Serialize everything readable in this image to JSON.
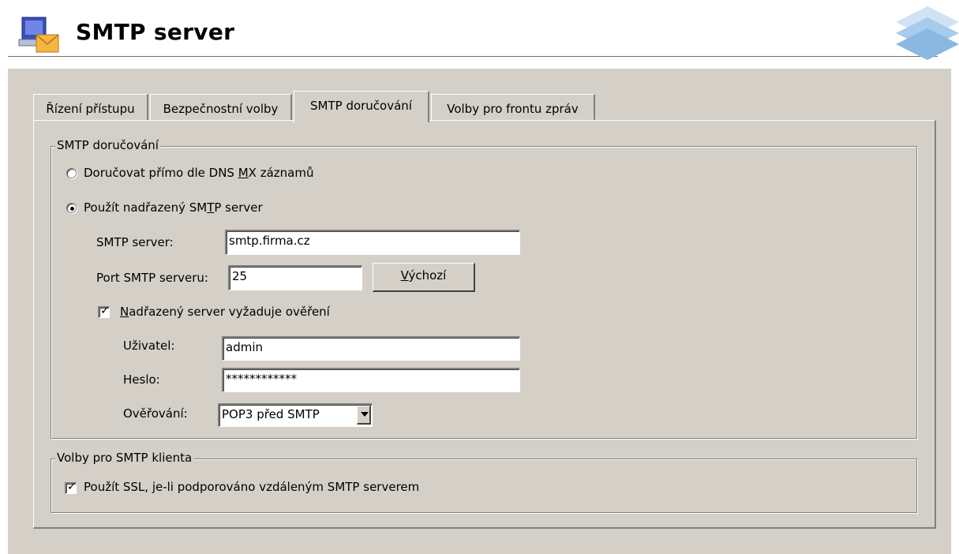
{
  "header": {
    "title": "SMTP server"
  },
  "tabs": [
    {
      "label": "Řízení přístupu"
    },
    {
      "label": "Bezpečnostní volby"
    },
    {
      "label": "SMTP doručování",
      "active": true
    },
    {
      "label": "Volby pro frontu zpráv"
    }
  ],
  "delivery": {
    "group_title": "SMTP doručování",
    "option_direct": {
      "pre": "Doručovat přímo dle DNS ",
      "mnemonic": "M",
      "post": "X záznamů",
      "selected": false
    },
    "option_relay": {
      "pre": "Použít nadřazený SM",
      "mnemonic": "T",
      "post": "P server",
      "selected": true
    },
    "server_label": "SMTP server:",
    "server_value": "smtp.firma.cz",
    "port_label": "Port SMTP serveru:",
    "port_value": "25",
    "default_button": {
      "mnemonic": "V",
      "rest": "ýchozí"
    },
    "auth_required": {
      "mnemonic": "N",
      "rest": "adřazený server vyžaduje ověření",
      "checked": true
    },
    "user_label": "Uživatel:",
    "user_value": "admin",
    "password_label": "Heslo:",
    "password_value": "************",
    "auth_label": "Ověřování:",
    "auth_selected": "POP3 před SMTP"
  },
  "client": {
    "group_title": "Volby pro SMTP klienta",
    "use_ssl": {
      "label": "Použít SSL, je-li podporováno vzdáleným SMTP serverem",
      "checked": true
    }
  },
  "colors": {
    "dialog_bg": "#d4d0c8",
    "field_bg": "#ffffff",
    "shadow": "#808080"
  }
}
